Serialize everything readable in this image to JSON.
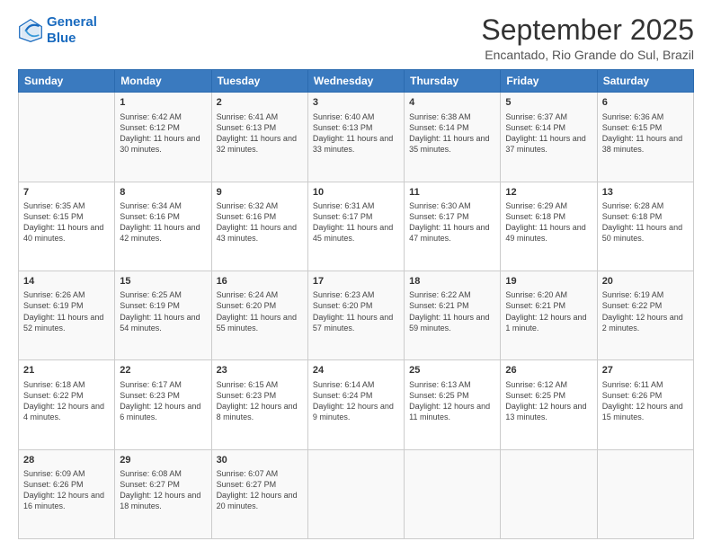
{
  "logo": {
    "line1": "General",
    "line2": "Blue"
  },
  "title": "September 2025",
  "location": "Encantado, Rio Grande do Sul, Brazil",
  "days_of_week": [
    "Sunday",
    "Monday",
    "Tuesday",
    "Wednesday",
    "Thursday",
    "Friday",
    "Saturday"
  ],
  "weeks": [
    [
      {
        "day": "",
        "sunrise": "",
        "sunset": "",
        "daylight": ""
      },
      {
        "day": "1",
        "sunrise": "Sunrise: 6:42 AM",
        "sunset": "Sunset: 6:12 PM",
        "daylight": "Daylight: 11 hours and 30 minutes."
      },
      {
        "day": "2",
        "sunrise": "Sunrise: 6:41 AM",
        "sunset": "Sunset: 6:13 PM",
        "daylight": "Daylight: 11 hours and 32 minutes."
      },
      {
        "day": "3",
        "sunrise": "Sunrise: 6:40 AM",
        "sunset": "Sunset: 6:13 PM",
        "daylight": "Daylight: 11 hours and 33 minutes."
      },
      {
        "day": "4",
        "sunrise": "Sunrise: 6:38 AM",
        "sunset": "Sunset: 6:14 PM",
        "daylight": "Daylight: 11 hours and 35 minutes."
      },
      {
        "day": "5",
        "sunrise": "Sunrise: 6:37 AM",
        "sunset": "Sunset: 6:14 PM",
        "daylight": "Daylight: 11 hours and 37 minutes."
      },
      {
        "day": "6",
        "sunrise": "Sunrise: 6:36 AM",
        "sunset": "Sunset: 6:15 PM",
        "daylight": "Daylight: 11 hours and 38 minutes."
      }
    ],
    [
      {
        "day": "7",
        "sunrise": "Sunrise: 6:35 AM",
        "sunset": "Sunset: 6:15 PM",
        "daylight": "Daylight: 11 hours and 40 minutes."
      },
      {
        "day": "8",
        "sunrise": "Sunrise: 6:34 AM",
        "sunset": "Sunset: 6:16 PM",
        "daylight": "Daylight: 11 hours and 42 minutes."
      },
      {
        "day": "9",
        "sunrise": "Sunrise: 6:32 AM",
        "sunset": "Sunset: 6:16 PM",
        "daylight": "Daylight: 11 hours and 43 minutes."
      },
      {
        "day": "10",
        "sunrise": "Sunrise: 6:31 AM",
        "sunset": "Sunset: 6:17 PM",
        "daylight": "Daylight: 11 hours and 45 minutes."
      },
      {
        "day": "11",
        "sunrise": "Sunrise: 6:30 AM",
        "sunset": "Sunset: 6:17 PM",
        "daylight": "Daylight: 11 hours and 47 minutes."
      },
      {
        "day": "12",
        "sunrise": "Sunrise: 6:29 AM",
        "sunset": "Sunset: 6:18 PM",
        "daylight": "Daylight: 11 hours and 49 minutes."
      },
      {
        "day": "13",
        "sunrise": "Sunrise: 6:28 AM",
        "sunset": "Sunset: 6:18 PM",
        "daylight": "Daylight: 11 hours and 50 minutes."
      }
    ],
    [
      {
        "day": "14",
        "sunrise": "Sunrise: 6:26 AM",
        "sunset": "Sunset: 6:19 PM",
        "daylight": "Daylight: 11 hours and 52 minutes."
      },
      {
        "day": "15",
        "sunrise": "Sunrise: 6:25 AM",
        "sunset": "Sunset: 6:19 PM",
        "daylight": "Daylight: 11 hours and 54 minutes."
      },
      {
        "day": "16",
        "sunrise": "Sunrise: 6:24 AM",
        "sunset": "Sunset: 6:20 PM",
        "daylight": "Daylight: 11 hours and 55 minutes."
      },
      {
        "day": "17",
        "sunrise": "Sunrise: 6:23 AM",
        "sunset": "Sunset: 6:20 PM",
        "daylight": "Daylight: 11 hours and 57 minutes."
      },
      {
        "day": "18",
        "sunrise": "Sunrise: 6:22 AM",
        "sunset": "Sunset: 6:21 PM",
        "daylight": "Daylight: 11 hours and 59 minutes."
      },
      {
        "day": "19",
        "sunrise": "Sunrise: 6:20 AM",
        "sunset": "Sunset: 6:21 PM",
        "daylight": "Daylight: 12 hours and 1 minute."
      },
      {
        "day": "20",
        "sunrise": "Sunrise: 6:19 AM",
        "sunset": "Sunset: 6:22 PM",
        "daylight": "Daylight: 12 hours and 2 minutes."
      }
    ],
    [
      {
        "day": "21",
        "sunrise": "Sunrise: 6:18 AM",
        "sunset": "Sunset: 6:22 PM",
        "daylight": "Daylight: 12 hours and 4 minutes."
      },
      {
        "day": "22",
        "sunrise": "Sunrise: 6:17 AM",
        "sunset": "Sunset: 6:23 PM",
        "daylight": "Daylight: 12 hours and 6 minutes."
      },
      {
        "day": "23",
        "sunrise": "Sunrise: 6:15 AM",
        "sunset": "Sunset: 6:23 PM",
        "daylight": "Daylight: 12 hours and 8 minutes."
      },
      {
        "day": "24",
        "sunrise": "Sunrise: 6:14 AM",
        "sunset": "Sunset: 6:24 PM",
        "daylight": "Daylight: 12 hours and 9 minutes."
      },
      {
        "day": "25",
        "sunrise": "Sunrise: 6:13 AM",
        "sunset": "Sunset: 6:25 PM",
        "daylight": "Daylight: 12 hours and 11 minutes."
      },
      {
        "day": "26",
        "sunrise": "Sunrise: 6:12 AM",
        "sunset": "Sunset: 6:25 PM",
        "daylight": "Daylight: 12 hours and 13 minutes."
      },
      {
        "day": "27",
        "sunrise": "Sunrise: 6:11 AM",
        "sunset": "Sunset: 6:26 PM",
        "daylight": "Daylight: 12 hours and 15 minutes."
      }
    ],
    [
      {
        "day": "28",
        "sunrise": "Sunrise: 6:09 AM",
        "sunset": "Sunset: 6:26 PM",
        "daylight": "Daylight: 12 hours and 16 minutes."
      },
      {
        "day": "29",
        "sunrise": "Sunrise: 6:08 AM",
        "sunset": "Sunset: 6:27 PM",
        "daylight": "Daylight: 12 hours and 18 minutes."
      },
      {
        "day": "30",
        "sunrise": "Sunrise: 6:07 AM",
        "sunset": "Sunset: 6:27 PM",
        "daylight": "Daylight: 12 hours and 20 minutes."
      },
      {
        "day": "",
        "sunrise": "",
        "sunset": "",
        "daylight": ""
      },
      {
        "day": "",
        "sunrise": "",
        "sunset": "",
        "daylight": ""
      },
      {
        "day": "",
        "sunrise": "",
        "sunset": "",
        "daylight": ""
      },
      {
        "day": "",
        "sunrise": "",
        "sunset": "",
        "daylight": ""
      }
    ]
  ]
}
